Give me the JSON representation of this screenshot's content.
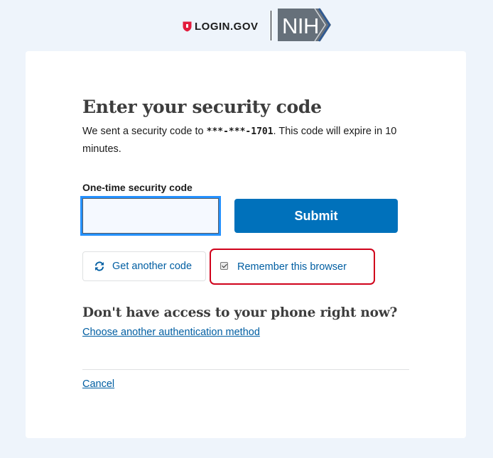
{
  "header": {
    "login_logo_text": "LOGIN.GOV",
    "partner_logo_text": "NIH"
  },
  "page": {
    "title": "Enter your security code",
    "intro_prefix": "We sent a security code to ",
    "masked_phone": "***-***-1701",
    "intro_suffix": ". This code will expire in 10 minutes."
  },
  "form": {
    "code_label": "One-time security code",
    "code_value": "",
    "submit_label": "Submit",
    "get_another_code_label": "Get another code",
    "remember_browser_label": "Remember this browser",
    "remember_browser_checked": true
  },
  "alternatives": {
    "heading": "Don't have access to your phone right now?",
    "choose_other_label": "Choose another authentication method"
  },
  "footer": {
    "cancel_label": "Cancel"
  },
  "colors": {
    "page_bg": "#eef4fb",
    "primary": "#0071bb",
    "link": "#005ea2",
    "highlight_border": "#d0021b",
    "login_red": "#e21c3d",
    "nih_gray": "#66707a"
  }
}
